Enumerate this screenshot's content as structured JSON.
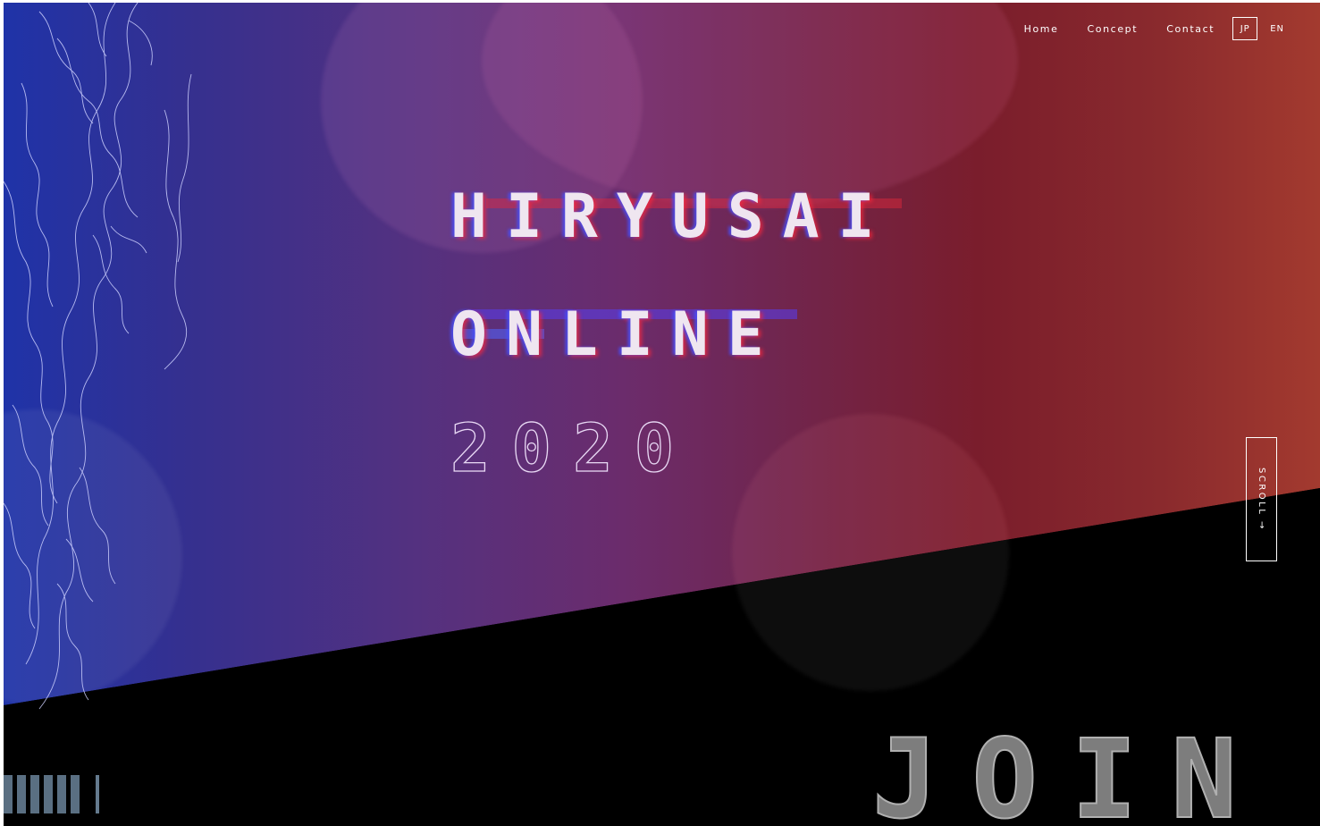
{
  "nav": {
    "items": [
      "Home",
      "Concept",
      "Contact"
    ],
    "lang_active": "JP",
    "lang_other": "EN"
  },
  "hero": {
    "title_line1": "HIRYUSAI",
    "title_line2": "ONLINE",
    "year": "2020"
  },
  "scroll_label": "SCROLL →",
  "join_label": "JOIN",
  "colors": {
    "gradient_left": "#1f33a8",
    "gradient_mid": "#6b2c6c",
    "gradient_right": "#a33a2f",
    "lower_band": "#000000",
    "join_fill": "#7d7d7d"
  },
  "icons": [
    "dragon-line-art-icon",
    "progress-bars-icon"
  ]
}
